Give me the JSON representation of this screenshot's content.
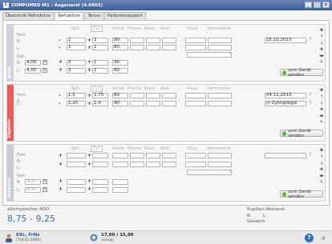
{
  "window": {
    "title": "COMPUMED M1 - Augenarzt (4.0903)",
    "controls": [
      "_",
      "□",
      "x"
    ]
  },
  "tabs": [
    {
      "label": "Übersicht Refraktion",
      "active": false
    },
    {
      "label": "Refraktion",
      "active": true
    },
    {
      "label": "Tenso",
      "active": false
    },
    {
      "label": "Patientenexport",
      "active": false
    }
  ],
  "columns": {
    "sph": "Sph.",
    "cyl": "Cyl.",
    "achse": "Achse",
    "prisma": "Prisma",
    "basis": "Basis",
    "abst": "Abst.",
    "visus": "Visus",
    "kommentar": "Kommentar"
  },
  "row_labels": {
    "fern": "Fern",
    "r": "R:",
    "l": "L:",
    "nah": "Nah"
  },
  "panels": [
    {
      "side_label": "Brille",
      "fern_r": {
        "sign": "-",
        "sph": "1",
        "cyl_sign": "+",
        "cyl": "1",
        "achse": "90"
      },
      "fern_l": {
        "sign": "-",
        "sph": "1",
        "cyl_sign": "+",
        "cyl": "1",
        "achse": "80"
      },
      "nah_r": {
        "add": "4,00",
        "sign": "+",
        "sph": "3",
        "cyl_sign": "+",
        "cyl": "1",
        "achse": "90"
      },
      "nah_l": {
        "add": "4,00",
        "sign": "+",
        "sph": "3",
        "cyl_sign": "+",
        "cyl": "1",
        "achse": "80"
      },
      "date": "15.10.2013",
      "comment": "",
      "send_label": "zum Gerät senden"
    },
    {
      "side_label": "Objektiv",
      "fern_r": {
        "sign": "-",
        "sph": "1,5",
        "cyl_sign": "+",
        "cyl": "1,75",
        "achse": "80"
      },
      "fern_l": {
        "sign": "-",
        "sph": "1,25",
        "cyl_sign": "+",
        "cyl": "1,0",
        "achse": "90"
      },
      "date": "04.11.2013",
      "comment": "in Zykloplegie",
      "send_label": "zum Gerät senden"
    },
    {
      "side_label": "Subjektiv",
      "nah_r_add": "ADD",
      "nah_l_add": "ADD",
      "send_label": "zum Gerät senden"
    }
  ],
  "age_add": {
    "label": "altertypischer ADD:",
    "value": "8,75 - 9,25"
  },
  "pupil": {
    "label": "Pupillen-Abstand:",
    "r": "R:",
    "l": "L:",
    "gesamt": "Gesamt:"
  },
  "footer": {
    "patient_name": "ERL, FrNz",
    "patient_date": "(TOf.01.1985)",
    "session_time": "17,00 / 15,00",
    "session_sub": "anzeig",
    "help": "?"
  }
}
